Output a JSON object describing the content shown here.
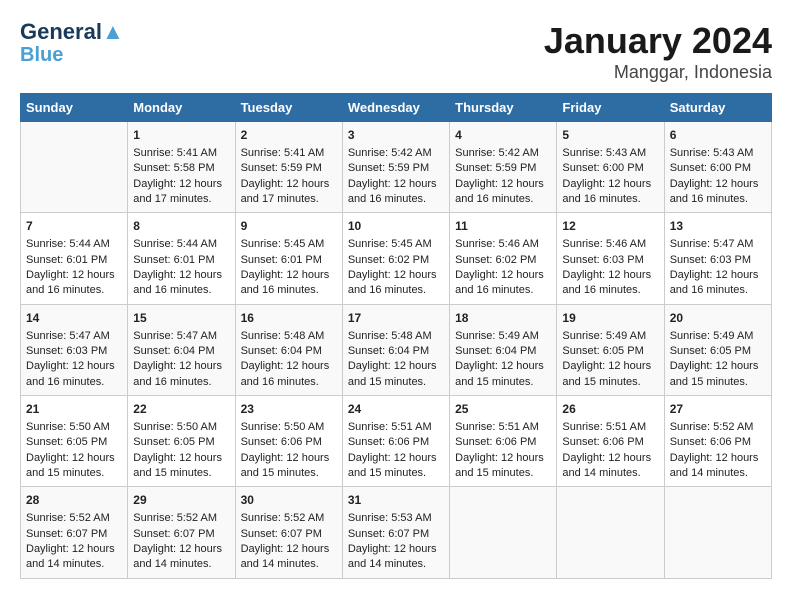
{
  "header": {
    "logo_line1": "General",
    "logo_line2": "Blue",
    "title": "January 2024",
    "subtitle": "Manggar, Indonesia"
  },
  "days_of_week": [
    "Sunday",
    "Monday",
    "Tuesday",
    "Wednesday",
    "Thursday",
    "Friday",
    "Saturday"
  ],
  "weeks": [
    [
      {
        "day": "",
        "sunrise": "",
        "sunset": "",
        "daylight": ""
      },
      {
        "day": "1",
        "sunrise": "Sunrise: 5:41 AM",
        "sunset": "Sunset: 5:58 PM",
        "daylight": "Daylight: 12 hours and 17 minutes."
      },
      {
        "day": "2",
        "sunrise": "Sunrise: 5:41 AM",
        "sunset": "Sunset: 5:59 PM",
        "daylight": "Daylight: 12 hours and 17 minutes."
      },
      {
        "day": "3",
        "sunrise": "Sunrise: 5:42 AM",
        "sunset": "Sunset: 5:59 PM",
        "daylight": "Daylight: 12 hours and 16 minutes."
      },
      {
        "day": "4",
        "sunrise": "Sunrise: 5:42 AM",
        "sunset": "Sunset: 5:59 PM",
        "daylight": "Daylight: 12 hours and 16 minutes."
      },
      {
        "day": "5",
        "sunrise": "Sunrise: 5:43 AM",
        "sunset": "Sunset: 6:00 PM",
        "daylight": "Daylight: 12 hours and 16 minutes."
      },
      {
        "day": "6",
        "sunrise": "Sunrise: 5:43 AM",
        "sunset": "Sunset: 6:00 PM",
        "daylight": "Daylight: 12 hours and 16 minutes."
      }
    ],
    [
      {
        "day": "7",
        "sunrise": "Sunrise: 5:44 AM",
        "sunset": "Sunset: 6:01 PM",
        "daylight": "Daylight: 12 hours and 16 minutes."
      },
      {
        "day": "8",
        "sunrise": "Sunrise: 5:44 AM",
        "sunset": "Sunset: 6:01 PM",
        "daylight": "Daylight: 12 hours and 16 minutes."
      },
      {
        "day": "9",
        "sunrise": "Sunrise: 5:45 AM",
        "sunset": "Sunset: 6:01 PM",
        "daylight": "Daylight: 12 hours and 16 minutes."
      },
      {
        "day": "10",
        "sunrise": "Sunrise: 5:45 AM",
        "sunset": "Sunset: 6:02 PM",
        "daylight": "Daylight: 12 hours and 16 minutes."
      },
      {
        "day": "11",
        "sunrise": "Sunrise: 5:46 AM",
        "sunset": "Sunset: 6:02 PM",
        "daylight": "Daylight: 12 hours and 16 minutes."
      },
      {
        "day": "12",
        "sunrise": "Sunrise: 5:46 AM",
        "sunset": "Sunset: 6:03 PM",
        "daylight": "Daylight: 12 hours and 16 minutes."
      },
      {
        "day": "13",
        "sunrise": "Sunrise: 5:47 AM",
        "sunset": "Sunset: 6:03 PM",
        "daylight": "Daylight: 12 hours and 16 minutes."
      }
    ],
    [
      {
        "day": "14",
        "sunrise": "Sunrise: 5:47 AM",
        "sunset": "Sunset: 6:03 PM",
        "daylight": "Daylight: 12 hours and 16 minutes."
      },
      {
        "day": "15",
        "sunrise": "Sunrise: 5:47 AM",
        "sunset": "Sunset: 6:04 PM",
        "daylight": "Daylight: 12 hours and 16 minutes."
      },
      {
        "day": "16",
        "sunrise": "Sunrise: 5:48 AM",
        "sunset": "Sunset: 6:04 PM",
        "daylight": "Daylight: 12 hours and 16 minutes."
      },
      {
        "day": "17",
        "sunrise": "Sunrise: 5:48 AM",
        "sunset": "Sunset: 6:04 PM",
        "daylight": "Daylight: 12 hours and 15 minutes."
      },
      {
        "day": "18",
        "sunrise": "Sunrise: 5:49 AM",
        "sunset": "Sunset: 6:04 PM",
        "daylight": "Daylight: 12 hours and 15 minutes."
      },
      {
        "day": "19",
        "sunrise": "Sunrise: 5:49 AM",
        "sunset": "Sunset: 6:05 PM",
        "daylight": "Daylight: 12 hours and 15 minutes."
      },
      {
        "day": "20",
        "sunrise": "Sunrise: 5:49 AM",
        "sunset": "Sunset: 6:05 PM",
        "daylight": "Daylight: 12 hours and 15 minutes."
      }
    ],
    [
      {
        "day": "21",
        "sunrise": "Sunrise: 5:50 AM",
        "sunset": "Sunset: 6:05 PM",
        "daylight": "Daylight: 12 hours and 15 minutes."
      },
      {
        "day": "22",
        "sunrise": "Sunrise: 5:50 AM",
        "sunset": "Sunset: 6:05 PM",
        "daylight": "Daylight: 12 hours and 15 minutes."
      },
      {
        "day": "23",
        "sunrise": "Sunrise: 5:50 AM",
        "sunset": "Sunset: 6:06 PM",
        "daylight": "Daylight: 12 hours and 15 minutes."
      },
      {
        "day": "24",
        "sunrise": "Sunrise: 5:51 AM",
        "sunset": "Sunset: 6:06 PM",
        "daylight": "Daylight: 12 hours and 15 minutes."
      },
      {
        "day": "25",
        "sunrise": "Sunrise: 5:51 AM",
        "sunset": "Sunset: 6:06 PM",
        "daylight": "Daylight: 12 hours and 15 minutes."
      },
      {
        "day": "26",
        "sunrise": "Sunrise: 5:51 AM",
        "sunset": "Sunset: 6:06 PM",
        "daylight": "Daylight: 12 hours and 14 minutes."
      },
      {
        "day": "27",
        "sunrise": "Sunrise: 5:52 AM",
        "sunset": "Sunset: 6:06 PM",
        "daylight": "Daylight: 12 hours and 14 minutes."
      }
    ],
    [
      {
        "day": "28",
        "sunrise": "Sunrise: 5:52 AM",
        "sunset": "Sunset: 6:07 PM",
        "daylight": "Daylight: 12 hours and 14 minutes."
      },
      {
        "day": "29",
        "sunrise": "Sunrise: 5:52 AM",
        "sunset": "Sunset: 6:07 PM",
        "daylight": "Daylight: 12 hours and 14 minutes."
      },
      {
        "day": "30",
        "sunrise": "Sunrise: 5:52 AM",
        "sunset": "Sunset: 6:07 PM",
        "daylight": "Daylight: 12 hours and 14 minutes."
      },
      {
        "day": "31",
        "sunrise": "Sunrise: 5:53 AM",
        "sunset": "Sunset: 6:07 PM",
        "daylight": "Daylight: 12 hours and 14 minutes."
      },
      {
        "day": "",
        "sunrise": "",
        "sunset": "",
        "daylight": ""
      },
      {
        "day": "",
        "sunrise": "",
        "sunset": "",
        "daylight": ""
      },
      {
        "day": "",
        "sunrise": "",
        "sunset": "",
        "daylight": ""
      }
    ]
  ]
}
